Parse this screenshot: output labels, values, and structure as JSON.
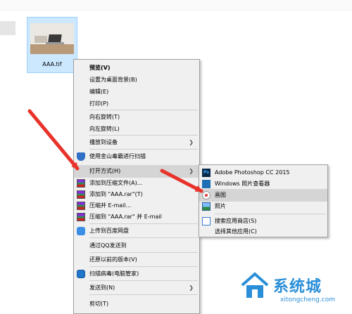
{
  "file": {
    "name": "AAA.tif"
  },
  "context_menu": {
    "items": [
      {
        "label": "预览(V)",
        "bold": true
      },
      {
        "label": "设置为桌面背景(B)"
      },
      {
        "label": "编辑(E)"
      },
      {
        "label": "打印(P)"
      },
      {
        "label": "向右旋转(T)"
      },
      {
        "label": "向左旋转(L)"
      },
      {
        "label": "播放到设备"
      },
      {
        "label": "使用金山毒霸进行扫描"
      },
      {
        "label": "打开方式(H)"
      },
      {
        "label": "添加到压缩文件(A)..."
      },
      {
        "label": "添加到 \"AAA.rar\"(T)"
      },
      {
        "label": "压缩并 E-mail..."
      },
      {
        "label": "压缩到 \"AAA.rar\" 并 E-mail"
      },
      {
        "label": "上传到百度网盘"
      },
      {
        "label": "通过QQ发送到"
      },
      {
        "label": "还原以前的版本(V)"
      },
      {
        "label": "扫描病毒(电脑管家)"
      },
      {
        "label": "发送到(N)"
      },
      {
        "label": "剪切(T)"
      }
    ]
  },
  "open_with_menu": {
    "items": [
      {
        "label": "Adobe Photoshop CC 2015",
        "icon": "photoshop-icon"
      },
      {
        "label": "Windows 照片查看器",
        "icon": "photo-viewer-icon"
      },
      {
        "label": "画图",
        "icon": "paint-icon"
      },
      {
        "label": "照片",
        "icon": "photos-icon"
      },
      {
        "label": "搜索应用商店(S)",
        "icon": "store-icon"
      },
      {
        "label": "选择其他应用(C)"
      }
    ]
  },
  "watermark": {
    "brand": "系统城",
    "url": "xitongcheng.com"
  },
  "colors": {
    "arrow": "#e8322a",
    "selection": "#cce8ff",
    "menu_bg": "#f0f0f0"
  }
}
